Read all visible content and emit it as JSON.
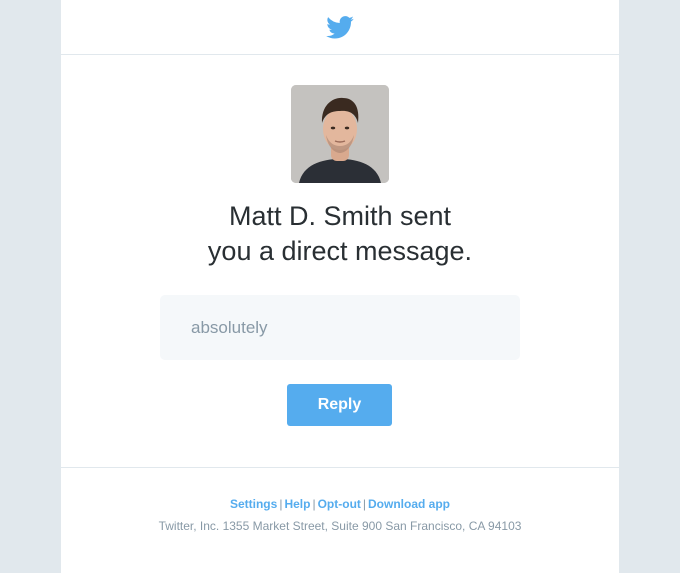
{
  "header": {
    "logo_icon": "twitter-bird-icon",
    "brand_color": "#55acee"
  },
  "notification": {
    "avatar_icon": "user-avatar-photo",
    "headline_line1": "Matt D. Smith sent",
    "headline_line2": "you a direct message.",
    "message_text": "absolutely",
    "reply_label": "Reply"
  },
  "footer": {
    "links": [
      "Settings",
      "Help",
      "Opt-out",
      "Download app"
    ],
    "separator": "|",
    "address": "Twitter, Inc. 1355 Market Street, Suite 900 San Francisco, CA 94103"
  },
  "colors": {
    "page_background": "#e1e8ed",
    "card_background": "#ffffff",
    "accent": "#55acee",
    "text_dark": "#292f33",
    "text_muted": "#8899a6"
  }
}
